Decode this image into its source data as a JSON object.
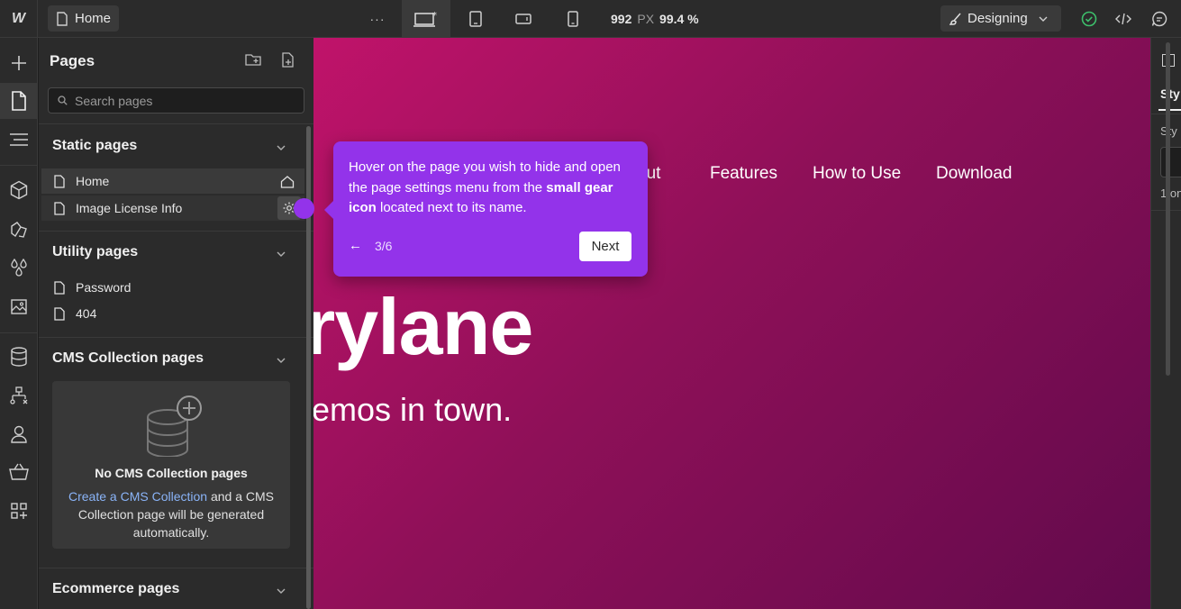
{
  "topbar": {
    "logo": "W",
    "current_page": "Home",
    "more": "···",
    "canvas_width": "992",
    "canvas_width_unit": "PX",
    "zoom": "99.4 %",
    "mode": "Designing"
  },
  "pages_panel": {
    "title": "Pages",
    "search_placeholder": "Search pages",
    "static": {
      "heading": "Static pages",
      "items": [
        {
          "label": "Home"
        },
        {
          "label": "Image License Info"
        }
      ]
    },
    "utility": {
      "heading": "Utility pages",
      "items": [
        {
          "label": "Password"
        },
        {
          "label": "404"
        }
      ]
    },
    "cms": {
      "heading": "CMS Collection pages",
      "empty_title": "No CMS Collection pages",
      "link": "Create a CMS Collection",
      "text": " and a CMS Collection page will be generated automatically."
    },
    "ecommerce": {
      "heading": "Ecommerce pages"
    }
  },
  "canvas": {
    "nav": [
      "out",
      "Features",
      "How to Use",
      "Download"
    ],
    "hero_title": "rylane",
    "hero_subtitle": "emos in town."
  },
  "tooltip": {
    "text_before": "Hover on the page you wish to hide and open the page settings menu from the ",
    "text_bold": "small gear icon",
    "text_after": " located next to its name.",
    "back": "←",
    "step": "3/6",
    "next": "Next",
    "color": "#9333ea"
  },
  "right_panel": {
    "tab": "Sty",
    "label": "Sty",
    "count": "1 on"
  }
}
